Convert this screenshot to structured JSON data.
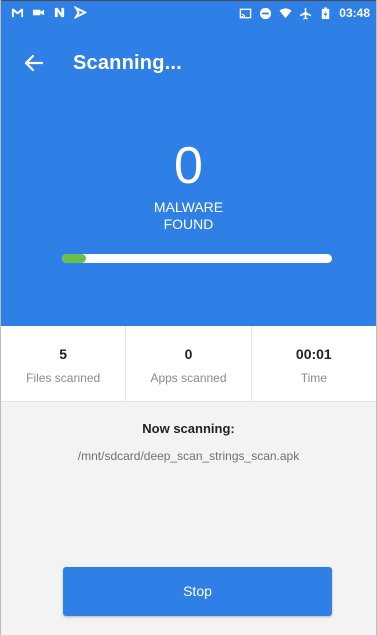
{
  "status_bar": {
    "time": "03:48",
    "left_icons": [
      "gmail-icon",
      "video-icon",
      "n-icon",
      "mic-off-icon"
    ],
    "right_icons": [
      "cast-icon",
      "do-not-disturb-icon",
      "wifi-icon",
      "airplane-icon",
      "battery-icon"
    ]
  },
  "toolbar": {
    "title": "Scanning...",
    "back_icon": "arrow-back-icon"
  },
  "scan": {
    "malware_count": "0",
    "found_line1": "MALWARE",
    "found_line2": "FOUND",
    "progress_fraction": 0.09
  },
  "stats": [
    {
      "value": "5",
      "label": "Files scanned"
    },
    {
      "value": "0",
      "label": "Apps scanned"
    },
    {
      "value": "00:01",
      "label": "Time"
    }
  ],
  "now_scanning": {
    "title": "Now scanning:",
    "path": "/mnt/sdcard/deep_scan_strings_scan.apk"
  },
  "actions": {
    "stop_label": "Stop"
  },
  "colors": {
    "primary": "#2f80e6",
    "progress_fill": "#6cc04a",
    "progress_track": "#ffffff",
    "background": "#f3f3f3"
  }
}
